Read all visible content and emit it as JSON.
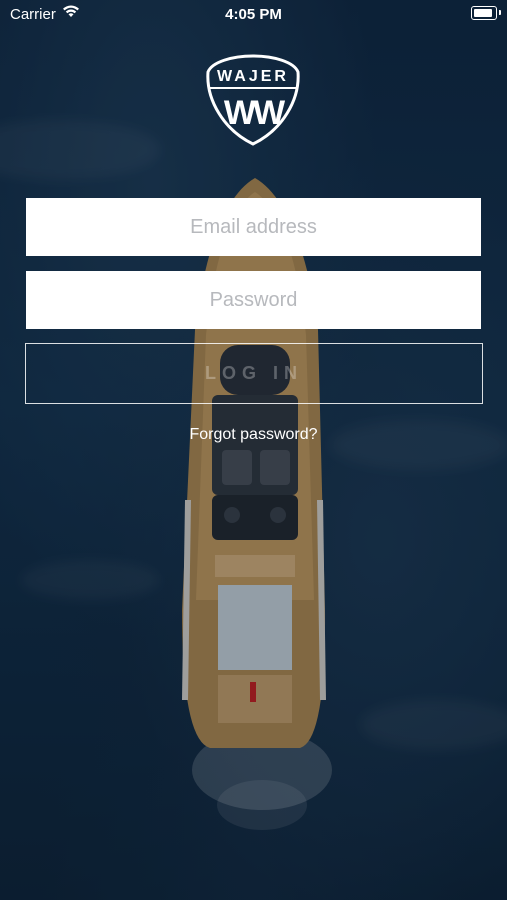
{
  "status_bar": {
    "carrier": "Carrier",
    "time": "4:05 PM"
  },
  "logo": {
    "brand": "WAJER",
    "monogram": "WW"
  },
  "form": {
    "email_placeholder": "Email address",
    "password_placeholder": "Password",
    "login_label": "LOG IN",
    "forgot_label": "Forgot password?"
  },
  "icons": {
    "wifi": "wifi-icon",
    "battery": "battery-icon"
  },
  "colors": {
    "ocean": "#12304b",
    "field_bg": "#ffffff",
    "placeholder": "#b7b9bd",
    "text": "#ffffff"
  }
}
